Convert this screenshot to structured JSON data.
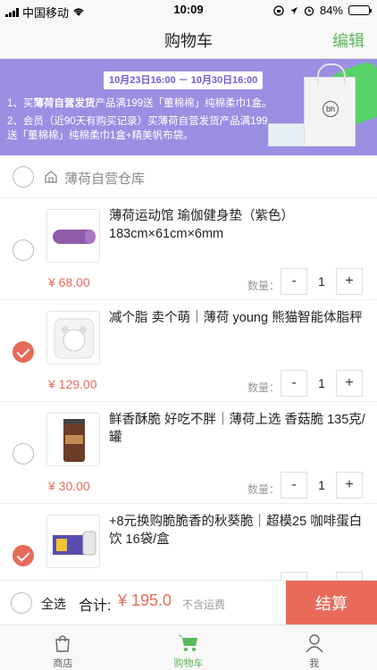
{
  "status_bar": {
    "carrier": "中国移动",
    "time": "10:09",
    "battery": "84%",
    "battery_level": 0.84
  },
  "nav": {
    "title": "购物车",
    "edit_label": "编辑"
  },
  "banner": {
    "date_range": "10月23日16:00 － 10月30日16:00",
    "promo_1_prefix": "1、买",
    "promo_1_bold": "薄荷自营发货",
    "promo_1_suffix": "产品满199送「董棉棉」纯棉柔巾1盒。",
    "promo_2": "2、会员（近90天有购买记录）买薄荷自营发货产品满199送「董棉棉」纯棉柔巾1盒+精美帆布袋。",
    "bag_logo": "bh"
  },
  "section": {
    "label": "薄荷自营仓库"
  },
  "items": [
    {
      "name": "薄荷运动馆 瑜伽健身垫（紫色）183cm×61cm×6mm",
      "price": "¥ 68.00",
      "qty_label": "数量：",
      "qty": "1",
      "minus": "-",
      "plus": "+",
      "checked": false
    },
    {
      "name": "减个脂 卖个萌｜薄荷 young 熊猫智能体脂秤",
      "price": "¥ 129.00",
      "qty_label": "数量：",
      "qty": "1",
      "minus": "-",
      "plus": "+",
      "checked": true
    },
    {
      "name": "鲜香酥脆 好吃不胖｜薄荷上选 香菇脆 135克/罐",
      "price": "¥ 30.00",
      "qty_label": "数量：",
      "qty": "1",
      "minus": "-",
      "plus": "+",
      "checked": false
    },
    {
      "name": "+8元换购脆脆香的秋葵脆｜超模25 咖啡蛋白饮 16袋/盒",
      "price": "",
      "qty_label": "",
      "qty": "",
      "minus": "-",
      "plus": "+",
      "checked": true
    }
  ],
  "bottom": {
    "select_all": "全选",
    "total_label": "合计:",
    "total_value": "¥ 195.0",
    "shipping_note": "不含运费",
    "checkout": "结算"
  },
  "tabs": [
    {
      "label": "商店",
      "icon": "bag-icon"
    },
    {
      "label": "购物车",
      "icon": "cart-icon",
      "active": true
    },
    {
      "label": "我",
      "icon": "person-icon"
    }
  ],
  "colors": {
    "accent": "#5cb85c",
    "price": "#e86b5a",
    "banner": "#9b8fe3"
  }
}
